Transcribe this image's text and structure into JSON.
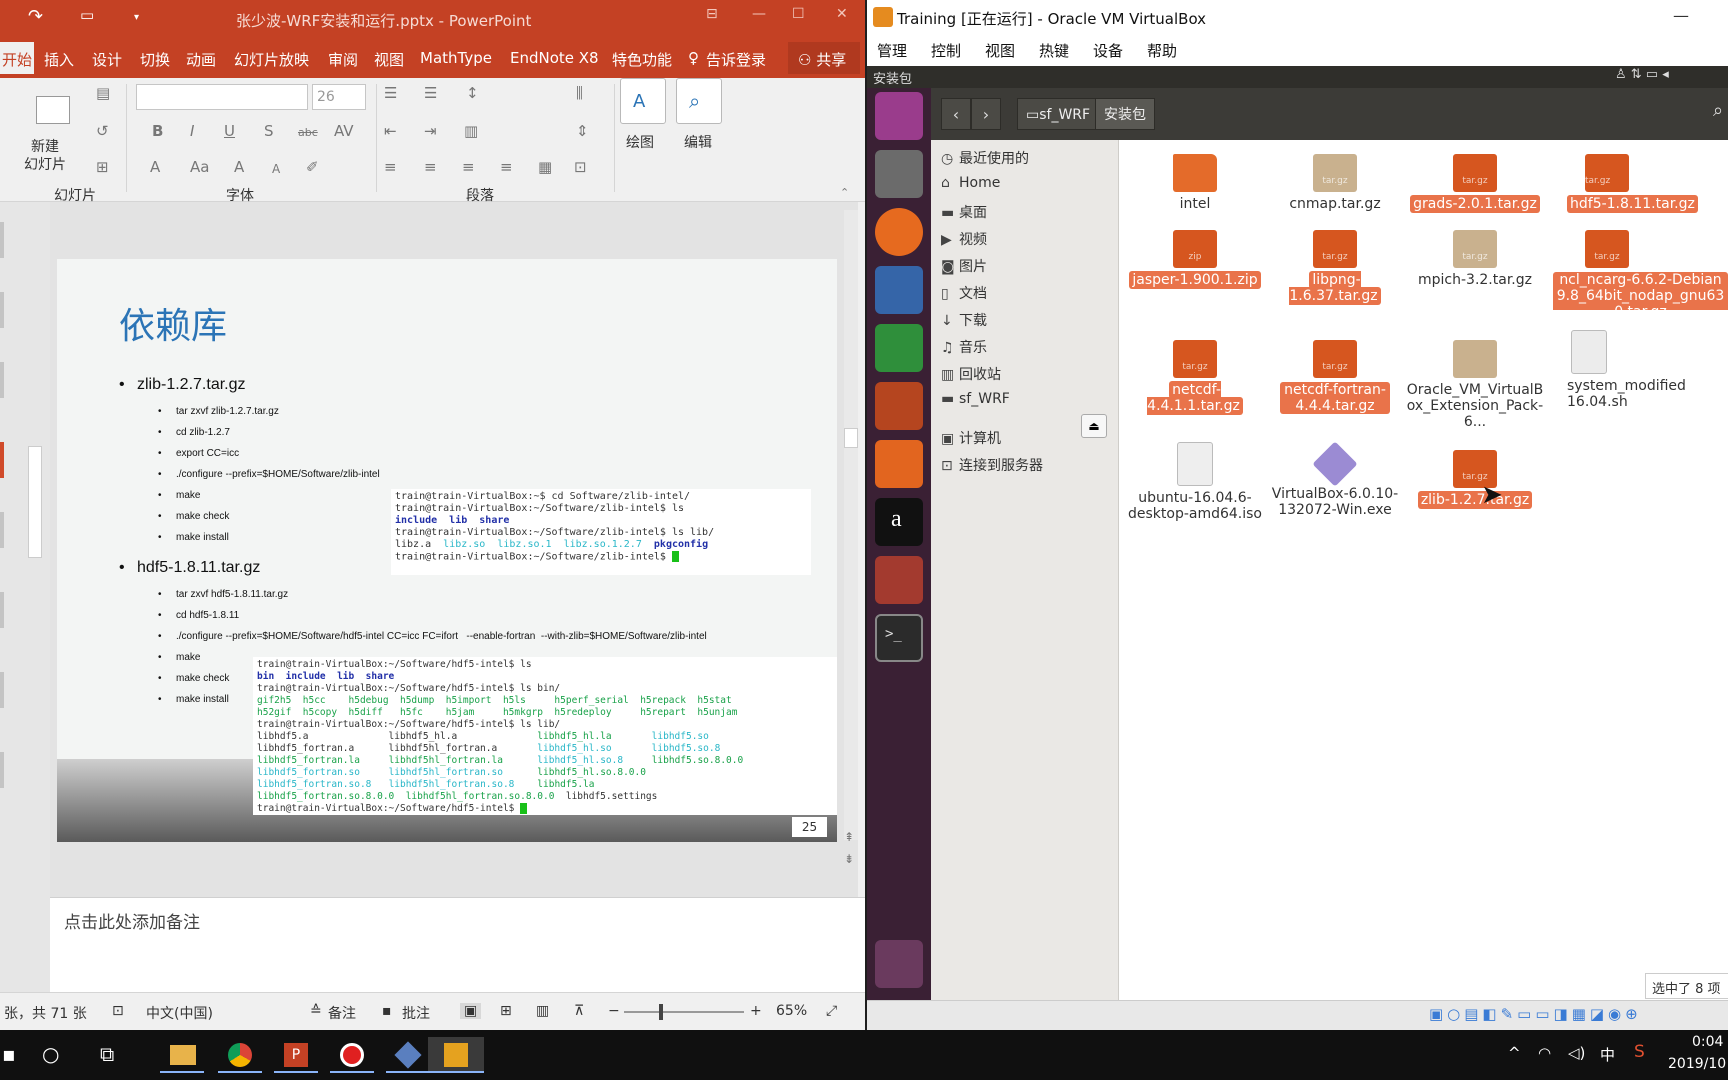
{
  "ppt": {
    "title": "张少波-WRF安装和运行.pptx - PowerPoint",
    "tabs": [
      "开始",
      "插入",
      "设计",
      "切换",
      "动画",
      "幻灯片放映",
      "审阅",
      "视图",
      "MathType",
      "EndNote X8",
      "特色功能"
    ],
    "tell": "告诉",
    "login": "登录",
    "share": "共享",
    "font_size": "26",
    "groups": {
      "slides": "幻灯片",
      "font": "字体",
      "paragraph": "段落"
    },
    "new_slide": "新建\n幻灯片",
    "draw": "绘图",
    "edit": "编辑",
    "slide": {
      "title": "依赖库",
      "zlib": "zlib-1.2.7.tar.gz",
      "zlib_steps": [
        "tar zxvf zlib-1.2.7.tar.gz",
        "cd zlib-1.2.7",
        "export CC=icc",
        "./configure --prefix=$HOME/Software/zlib-intel",
        "make",
        "make check",
        "make install"
      ],
      "hdf5": "hdf5-1.8.11.tar.gz",
      "hdf5_steps": [
        "tar zxvf hdf5-1.8.11.tar.gz",
        "cd hdf5-1.8.11",
        "./configure --prefix=$HOME/Software/hdf5-intel CC=icc FC=ifort   --enable-fortran  --with-zlib=$HOME/Software/zlib-intel",
        "make",
        "make check",
        "make install"
      ],
      "num": "25"
    },
    "notes": "点击此处添加备注",
    "status": {
      "slide": "张，共 71 张",
      "lang": "中文(中国)",
      "notes": "备注",
      "comments": "批注",
      "zoom": "65%"
    }
  },
  "vbox": {
    "title": "Training [正在运行] - Oracle VM VirtualBox",
    "menu": [
      "管理",
      "控制",
      "视图",
      "热键",
      "设备",
      "帮助"
    ],
    "topbar": "安装包",
    "crumbs": [
      "sf_WRF",
      "安装包"
    ],
    "sidebar": [
      "最近使用的",
      "Home",
      "桌面",
      "视频",
      "图片",
      "文档",
      "下载",
      "音乐",
      "回收站",
      "sf_WRF",
      "计算机",
      "连接到服务器"
    ],
    "files": [
      {
        "name": "intel",
        "type": "folder",
        "sel": false
      },
      {
        "name": "cnmap.tar.gz",
        "type": "tar.gz",
        "sel": false
      },
      {
        "name": "grads-2.0.1.tar.gz",
        "type": "tar.gz",
        "sel": true
      },
      {
        "name": "hdf5-1.8.11.tar.gz",
        "type": "tar.gz",
        "sel": true
      },
      {
        "name": "jasper-1.900.1.zip",
        "type": "zip",
        "sel": true
      },
      {
        "name": "libpng-1.6.37.tar.gz",
        "type": "tar.gz",
        "sel": true
      },
      {
        "name": "mpich-3.2.tar.gz",
        "type": "tar.gz",
        "sel": false
      },
      {
        "name": "ncl_ncarg-6.6.2-Debian9.8_64bit_nodap_gnu630.tar.gz",
        "type": "tar.gz",
        "sel": true
      },
      {
        "name": "netcdf-4.4.1.1.tar.gz",
        "type": "tar.gz",
        "sel": true
      },
      {
        "name": "netcdf-fortran-4.4.4.tar.gz",
        "type": "tar.gz",
        "sel": true
      },
      {
        "name": "Oracle_VM_VirtualBox_Extension_Pack-6...",
        "type": "box",
        "sel": false
      },
      {
        "name": "system_modified 16.04.sh",
        "type": "sh",
        "sel": false
      },
      {
        "name": "ubuntu-16.04.6-desktop-amd64.iso",
        "type": "iso",
        "sel": false
      },
      {
        "name": "VirtualBox-6.0.10-132072-Win.exe",
        "type": "exe",
        "sel": false
      },
      {
        "name": "zlib-1.2.7.tar.gz",
        "type": "tar.gz",
        "sel": true
      }
    ],
    "selinfo": "选中了 8 项"
  },
  "taskbar": {
    "time": "0:04",
    "date": "2019/10",
    "ime": "中"
  }
}
